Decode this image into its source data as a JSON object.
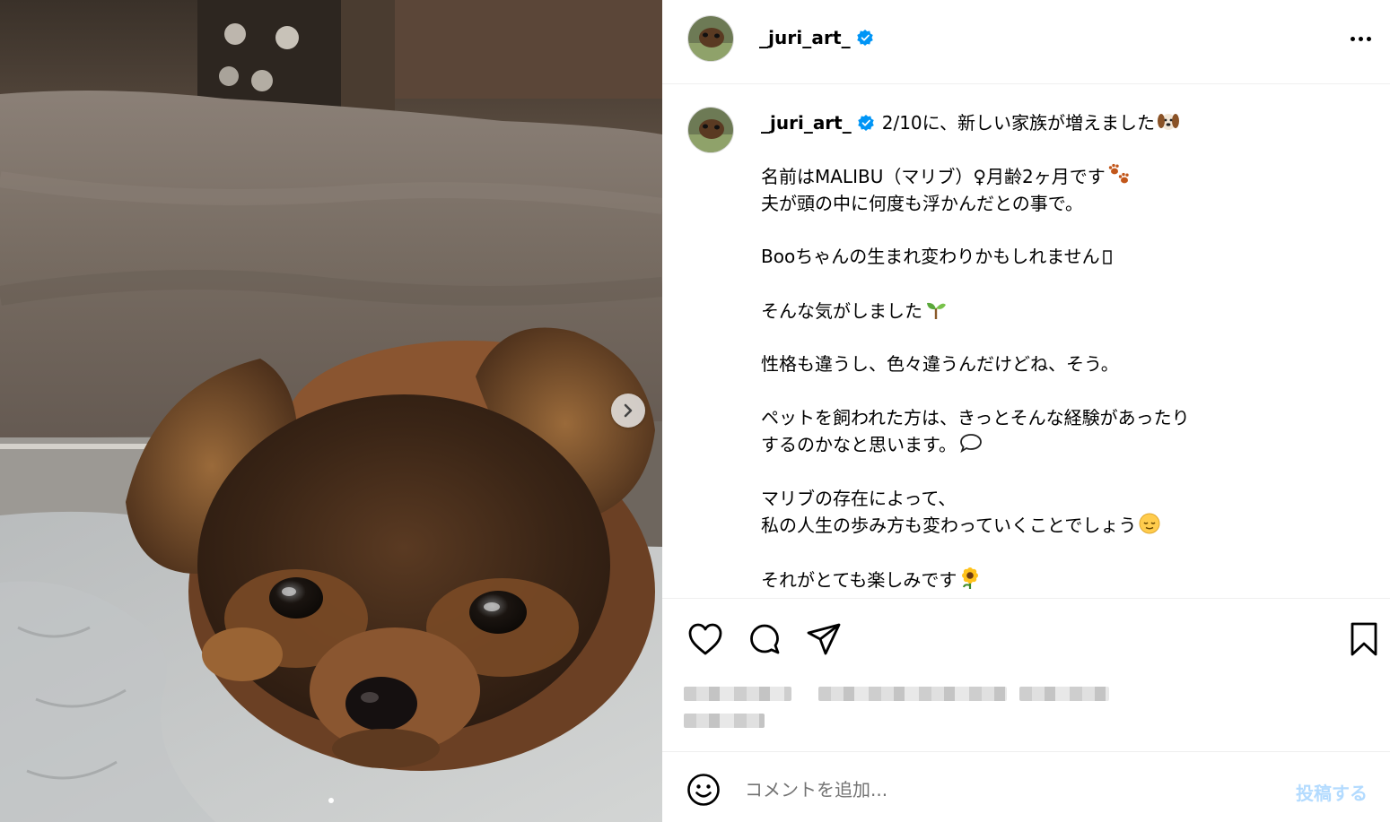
{
  "post": {
    "username": "_juri_art_",
    "verified": true,
    "image_alt": "dog photo",
    "carousel": {
      "current": 1,
      "total": 1
    }
  },
  "caption": {
    "username": "_juri_art_",
    "lines": [
      "2/10に、新しい家族が増えました",
      "",
      "名前はMALIBU（マリブ）♀月齢2ヶ月です",
      "夫が頭の中に何度も浮かんだとの事で。",
      "",
      "Booちゃんの生まれ変わりかもしれません",
      "",
      "そんな気がしました",
      "",
      "性格も違うし、色々違うんだけどね、そう。",
      "",
      "ペットを飼われた方は、きっとそんな経験があったり",
      "するのかなと思います。",
      "",
      "マリブの存在によって、",
      "私の人生の歩み方も変わっていくことでしょう",
      "",
      "それがとても楽しみです"
    ],
    "emojis": {
      "0": "dog-face-emoji",
      "2": "paw-prints-emoji",
      "5": "missing-glyph",
      "7": "seedling-emoji",
      "12": "speech-balloon-emoji",
      "15": "relieved-face-emoji",
      "17": "sunflower-emoji"
    }
  },
  "comment_bar": {
    "placeholder": "コメントを追加...",
    "post_label": "投稿する"
  },
  "colors": {
    "verified_blue": "#0095f6",
    "post_disabled": "#b3dbff",
    "divider": "#efefef"
  },
  "icons": [
    "heart-icon",
    "comment-icon",
    "share-icon",
    "bookmark-icon",
    "more-icon",
    "emoji-icon",
    "chevron-right-icon"
  ]
}
